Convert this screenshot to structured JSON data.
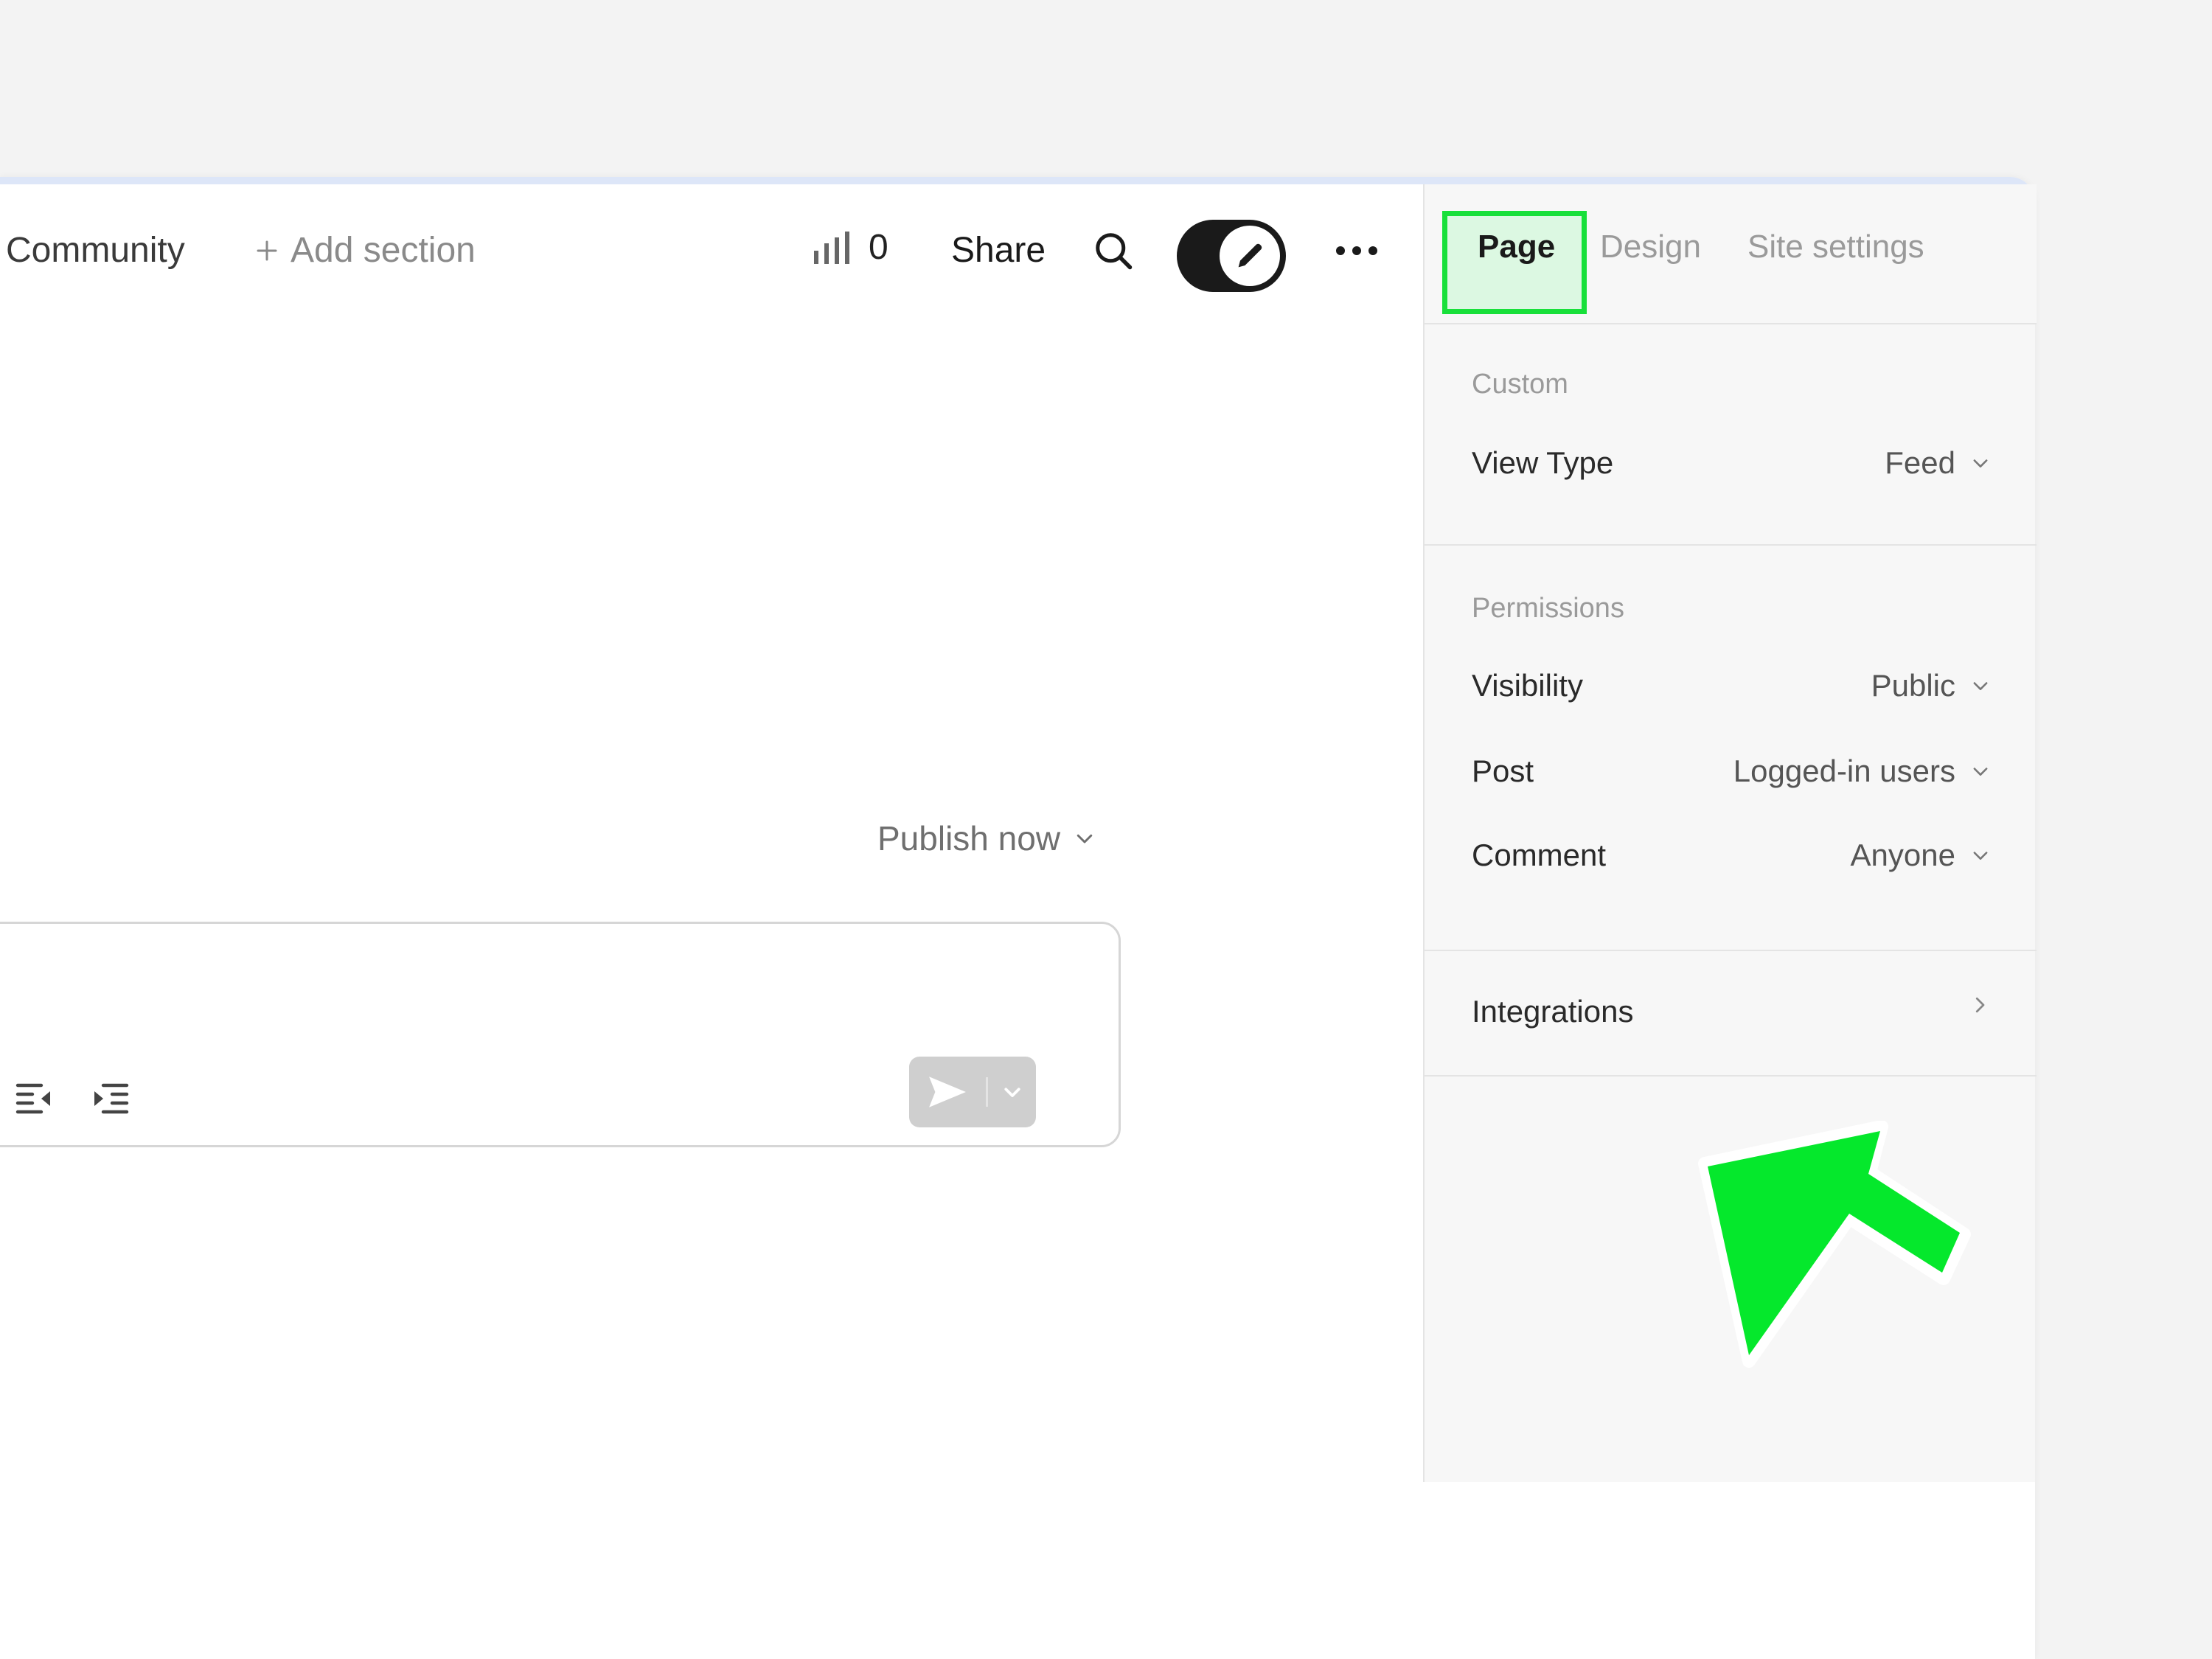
{
  "browser": {
    "toolbar_icons": [
      "zoom-in-icon",
      "star-icon",
      "extensions-icon",
      "profile-icon",
      "kebab-menu-icon"
    ]
  },
  "topnav": {
    "community": "Community",
    "add_section": "Add section",
    "stats_count": "0",
    "share": "Share"
  },
  "composer": {
    "publish_label": "Publish now"
  },
  "panel": {
    "tabs": [
      {
        "label": "Page",
        "active": true
      },
      {
        "label": "Design",
        "active": false
      },
      {
        "label": "Site settings",
        "active": false
      }
    ],
    "custom": {
      "title": "Custom",
      "view_type_label": "View Type",
      "view_type_value": "Feed"
    },
    "permissions": {
      "title": "Permissions",
      "rows": [
        {
          "label": "Visibility",
          "value": "Public"
        },
        {
          "label": "Post",
          "value": "Logged-in users"
        },
        {
          "label": "Comment",
          "value": "Anyone"
        }
      ]
    },
    "integrations_label": "Integrations"
  },
  "colors": {
    "highlight_green": "#18e03a",
    "highlight_fill": "#dcf8e2",
    "tabstrip": "#dde6f8",
    "toggle_dark": "#1a1a1a"
  }
}
